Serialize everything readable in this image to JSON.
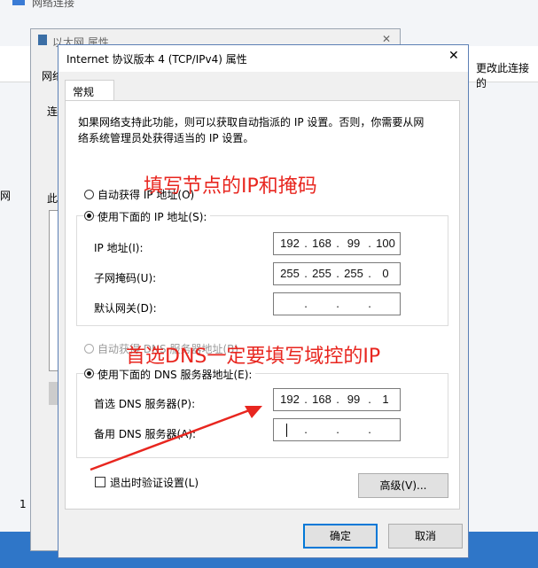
{
  "bg_windows": {
    "network_connections_title": "网络连接",
    "ethernet_props_title": "以太网 属性",
    "change_settings_link": "更改此连接的",
    "side_frags": [
      "网络",
      "连",
      "此",
      "网",
      "1"
    ]
  },
  "dialog": {
    "title": "Internet 协议版本 4 (TCP/IPv4) 属性",
    "tab_general": "常规",
    "description": "如果网络支持此功能，则可以获取自动指派的 IP 设置。否则，你需要从网络系统管理员处获得适当的 IP 设置。",
    "radio_auto_ip": "自动获得 IP 地址(O)",
    "radio_manual_ip": "使用下面的 IP 地址(S):",
    "label_ip": "IP 地址(I):",
    "label_mask": "子网掩码(U):",
    "label_gateway": "默认网关(D):",
    "ip_address": [
      "192",
      "168",
      "99",
      "100"
    ],
    "subnet_mask": [
      "255",
      "255",
      "255",
      "0"
    ],
    "gateway": [
      "",
      "",
      "",
      ""
    ],
    "radio_auto_dns": "自动获得 DNS 服务器地址(B)",
    "radio_manual_dns": "使用下面的 DNS 服务器地址(E):",
    "label_preferred_dns": "首选 DNS 服务器(P):",
    "label_alternate_dns": "备用 DNS 服务器(A):",
    "preferred_dns": [
      "192",
      "168",
      "99",
      "1"
    ],
    "alternate_dns": [
      "",
      "",
      "",
      ""
    ],
    "validate_checkbox": "退出时验证设置(L)",
    "advanced_button": "高级(V)...",
    "ok_button": "确定",
    "cancel_button": "取消"
  },
  "annotations": {
    "top_note": "填写节点的IP和掩码",
    "dns_note": "首选DNS一定要填写域控的IP",
    "color": "#e8261f"
  }
}
